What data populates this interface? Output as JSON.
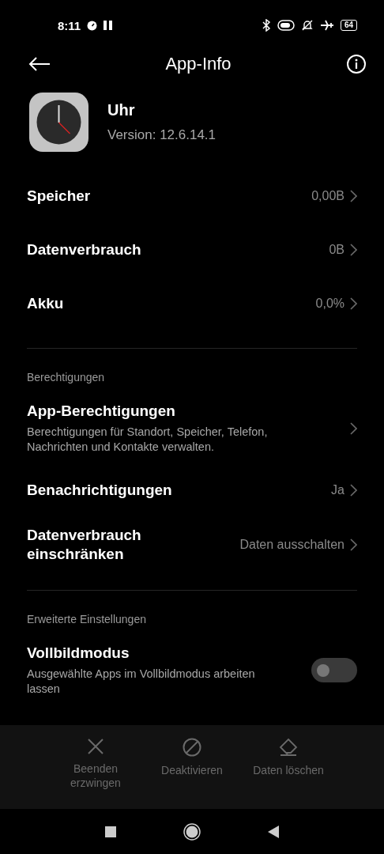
{
  "status_bar": {
    "time": "8:11",
    "battery": "64"
  },
  "header": {
    "title": "App-Info"
  },
  "app": {
    "name": "Uhr",
    "version": "Version: 12.6.14.1"
  },
  "sections": [
    {
      "items": [
        {
          "kind": "nav",
          "title": "Speicher",
          "value": "0,00B"
        },
        {
          "kind": "nav",
          "title": "Datenverbrauch",
          "value": "0B"
        },
        {
          "kind": "nav",
          "title": "Akku",
          "value": "0,0%"
        }
      ]
    },
    {
      "header": "Berechtigungen",
      "items": [
        {
          "kind": "nav",
          "title": "App-Berechtigungen",
          "subtitle": "Berechtigungen für Standort, Speicher, Telefon, Nachrichten und Kontakte verwalten."
        },
        {
          "kind": "nav",
          "title": "Benachrichtigungen",
          "value": "Ja"
        },
        {
          "kind": "nav",
          "title": "Datenverbrauch einschränken",
          "value": "Daten ausschalten"
        }
      ]
    },
    {
      "header": "Erweiterte Einstellungen",
      "items": [
        {
          "kind": "toggle",
          "title": "Vollbildmodus",
          "subtitle": "Ausgewählte Apps im Vollbildmodus arbeiten lassen",
          "on": false
        }
      ]
    }
  ],
  "actions": [
    {
      "kind": "stop",
      "label": "Beenden erzwingen",
      "disabled": true
    },
    {
      "kind": "disable",
      "label": "Deaktivieren",
      "disabled": true
    },
    {
      "kind": "clear",
      "label": "Daten löschen",
      "disabled": true
    }
  ]
}
